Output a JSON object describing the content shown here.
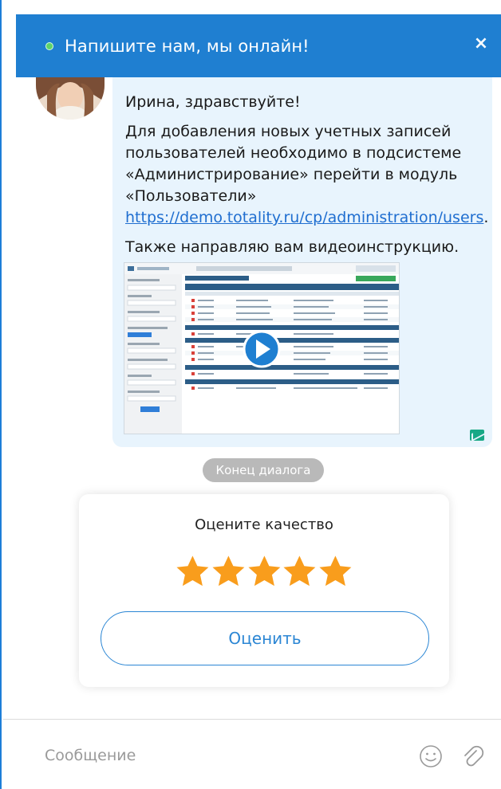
{
  "header": {
    "title": "Напишите нам, мы онлайн!",
    "close_label": "×"
  },
  "message": {
    "greeting": "Ирина, здравствуйте!",
    "body_prefix": "Для добавления новых учетных записей пользователей необходимо в подсистеме «Администрирование» перейти в модуль «Пользователи» ",
    "link_text": "https://demo.totality.ru/cp/administration/users",
    "body_suffix": ".",
    "video_note": "Также направляю вам видеоинструкцию.",
    "video_icon": "play-icon"
  },
  "end_of_dialog": "Конец диалога",
  "rating": {
    "title": "Оцените качество",
    "stars_selected": 5,
    "stars_total": 5,
    "button_label": "Оценить",
    "star_color": "#f99d1c"
  },
  "composer": {
    "placeholder": "Сообщение",
    "emoji_icon": "smile-icon",
    "attach_icon": "paperclip-icon"
  },
  "colors": {
    "header": "#1f7fd1",
    "bubble": "#e8f4fd",
    "link": "#1f6ed0",
    "accent": "#2b86d4",
    "pill": "#b9b9b9"
  }
}
